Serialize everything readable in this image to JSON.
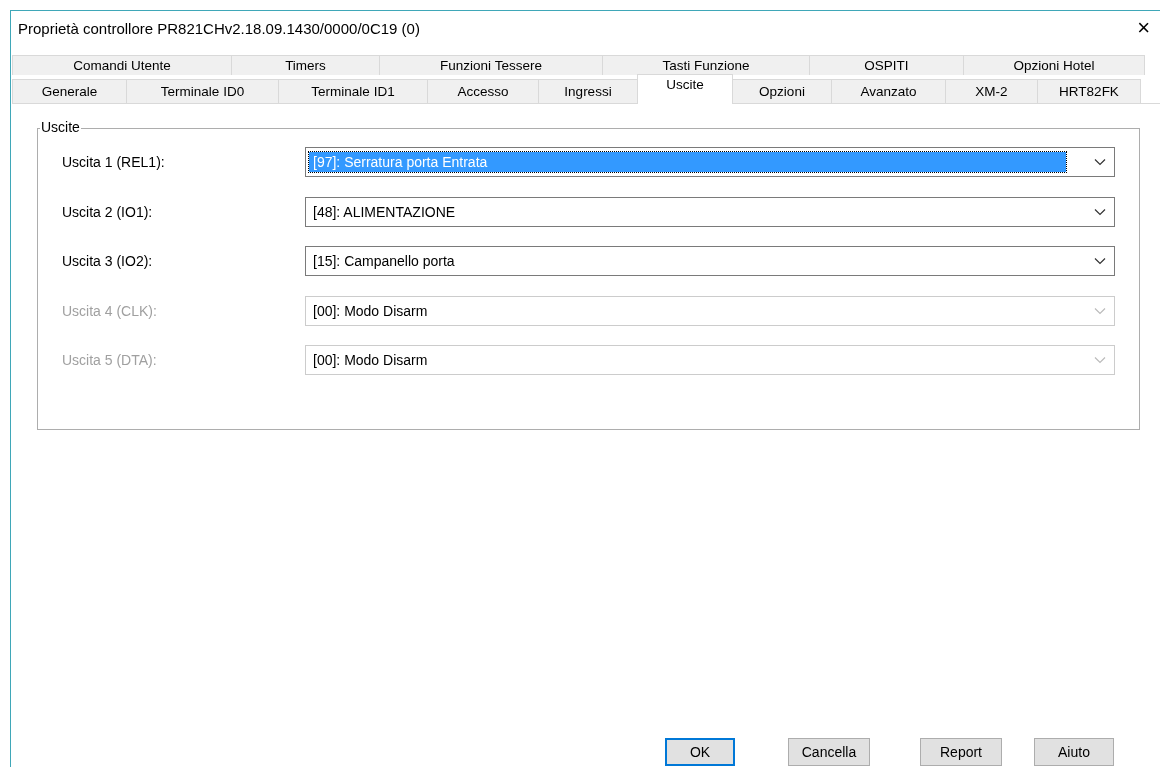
{
  "window": {
    "title": "Proprietà controllore PR821CHv2.18.09.1430/0000/0C19 (0)",
    "close": "×"
  },
  "tab_rows": [
    {
      "tabs": [
        {
          "label": "Comandi Utente",
          "selected": false
        },
        {
          "label": "Timers",
          "selected": false
        },
        {
          "label": "Funzioni Tessere",
          "selected": false
        },
        {
          "label": "Tasti Funzione",
          "selected": false
        },
        {
          "label": "OSPITI",
          "selected": false
        },
        {
          "label": "Opzioni Hotel",
          "selected": false
        }
      ]
    },
    {
      "tabs": [
        {
          "label": "Generale",
          "selected": false
        },
        {
          "label": "Terminale ID0",
          "selected": false
        },
        {
          "label": "Terminale ID1",
          "selected": false
        },
        {
          "label": "Accesso",
          "selected": false
        },
        {
          "label": "Ingressi",
          "selected": false
        },
        {
          "label": "Uscite",
          "selected": true
        },
        {
          "label": "Opzioni",
          "selected": false
        },
        {
          "label": "Avanzato",
          "selected": false
        },
        {
          "label": "XM-2",
          "selected": false
        },
        {
          "label": "HRT82FK",
          "selected": false
        }
      ]
    }
  ],
  "group": {
    "title": "Uscite",
    "rows": [
      {
        "label": "Uscita 1 (REL1):",
        "value": "[97]: Serratura porta Entrata",
        "disabled": false,
        "focused": true
      },
      {
        "label": "Uscita 2 (IO1):",
        "value": "[48]: ALIMENTAZIONE",
        "disabled": false,
        "focused": false
      },
      {
        "label": "Uscita 3 (IO2):",
        "value": "[15]: Campanello porta",
        "disabled": false,
        "focused": false
      },
      {
        "label": "Uscita 4 (CLK):",
        "value": "[00]: Modo Disarm",
        "disabled": true,
        "focused": false
      },
      {
        "label": "Uscita 5 (DTA):",
        "value": "[00]: Modo Disarm",
        "disabled": true,
        "focused": false
      }
    ]
  },
  "buttons": [
    {
      "label": "OK",
      "default": true
    },
    {
      "label": "Cancella",
      "default": false
    },
    {
      "label": "Report",
      "default": false
    },
    {
      "label": "Aiuto",
      "default": false
    }
  ]
}
